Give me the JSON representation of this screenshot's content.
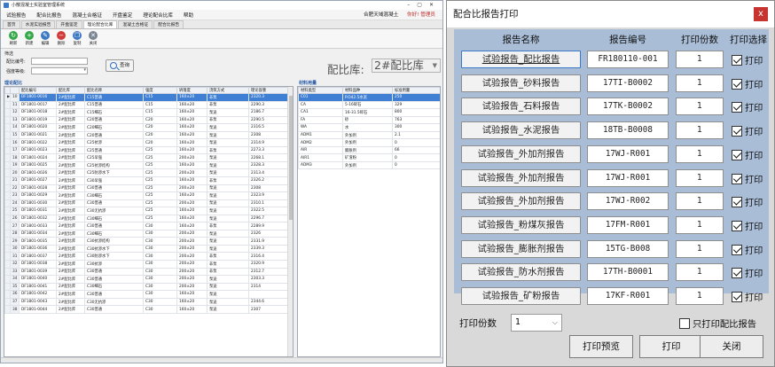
{
  "main_window": {
    "title": "小散混凝土实验室管理系统",
    "menu": [
      "试验报告",
      "配合比报告",
      "混凝土合格证",
      "开盘鉴定",
      "理论配合比库",
      "帮助"
    ],
    "company": "合肥天域混凝土",
    "user": "你好! 管理员",
    "tabs": [
      "首页",
      "水泥实验报告",
      "开盘鉴定",
      "理论配合比库",
      "混凝土合格证",
      "配合比报告"
    ],
    "active_tab_index": 3,
    "toolbar": [
      {
        "label": "刷新",
        "icon": "refresh-icon"
      },
      {
        "label": "新建",
        "icon": "add-icon"
      },
      {
        "label": "编辑",
        "icon": "edit-icon"
      },
      {
        "label": "删除",
        "icon": "delete-icon"
      },
      {
        "label": "复制",
        "icon": "copy-icon"
      },
      {
        "label": "关闭",
        "icon": "close-icon"
      }
    ],
    "filter": {
      "section_title": "筛选",
      "mix_no_label": "配比编号:",
      "strength_label": "强度等级:",
      "query_label": "查询",
      "library_label": "配比库:",
      "library_value": "2#配比库"
    },
    "mix_panel": {
      "title": "理论配比",
      "columns": [
        "",
        "",
        "配比编号",
        "配比库",
        "配比名称",
        "强度",
        "坍落度",
        "浇筑方式",
        "理论容重"
      ],
      "rows": [
        [
          "▶",
          "10",
          "DF1801-0016",
          "2#配比库",
          "C15普通",
          "C15",
          "160±20",
          "非泵",
          "2320.3"
        ],
        [
          "",
          "11",
          "DF1801-0017",
          "2#配比库",
          "C15普通",
          "C15",
          "160±20",
          "非泵",
          "2290.3"
        ],
        [
          "",
          "12",
          "DF1801-0018",
          "2#配比库",
          "C15细石",
          "C15",
          "160±20",
          "泵送",
          "2186.7"
        ],
        [
          "",
          "13",
          "DF1801-0019",
          "2#配比库",
          "C20普通",
          "C20",
          "160±20",
          "非泵",
          "2290.5"
        ],
        [
          "",
          "14",
          "DF1801-0020",
          "2#配比库",
          "C20细石",
          "C20",
          "160±20",
          "泵送",
          "2316.5"
        ],
        [
          "",
          "15",
          "DF1801-0021",
          "2#配比库",
          "C20普通",
          "C20",
          "160±20",
          "泵送",
          "2308"
        ],
        [
          "",
          "16",
          "DF1801-0022",
          "2#配比库",
          "C25抗渗",
          "C20",
          "160±20",
          "泵送",
          "2314.9"
        ],
        [
          "",
          "17",
          "DF1801-0023",
          "2#配比库",
          "C25普通",
          "C25",
          "160±20",
          "非泵",
          "2273.3"
        ],
        [
          "",
          "18",
          "DF1801-0024",
          "2#配比库",
          "C25早强",
          "C25",
          "200±20",
          "泵送",
          "2268.1"
        ],
        [
          "",
          "19",
          "DF1801-0025",
          "2#配比库",
          "C25抗渗结构",
          "C25",
          "160±20",
          "泵送",
          "2328.3"
        ],
        [
          "",
          "20",
          "DF1801-0026",
          "2#配比库",
          "C25防渗水下",
          "C25",
          "200±20",
          "泵送",
          "2313.4"
        ],
        [
          "",
          "21",
          "DF1801-0027",
          "2#配比库",
          "C30早强",
          "C25",
          "160±20",
          "非泵",
          "2326.2"
        ],
        [
          "",
          "22",
          "DF1801-0028",
          "2#配比库",
          "C30普通",
          "C25",
          "200±20",
          "泵送",
          "2308"
        ],
        [
          "",
          "23",
          "DF1801-0029",
          "2#配比库",
          "C30细石",
          "C25",
          "160±20",
          "泵送",
          "2323.9"
        ],
        [
          "",
          "24",
          "DF1801-0030",
          "2#配比库",
          "C30普通",
          "C25",
          "200±20",
          "泵送",
          "2310.1"
        ],
        [
          "",
          "25",
          "DF1801-0031",
          "2#配比库",
          "C30无抗渗",
          "C25",
          "160±20",
          "泵送",
          "2322.5"
        ],
        [
          "",
          "26",
          "DF1801-0032",
          "2#配比库",
          "C30细石",
          "C25",
          "160±20",
          "泵送",
          "2296.7"
        ],
        [
          "",
          "27",
          "DF1801-0033",
          "2#配比库",
          "C30普通",
          "C30",
          "160±20",
          "非泵",
          "2289.9"
        ],
        [
          "",
          "28",
          "DF1801-0034",
          "2#配比库",
          "C30细石",
          "C30",
          "200±20",
          "泵送",
          "2326"
        ],
        [
          "",
          "29",
          "DF1801-0035",
          "2#配比库",
          "C30抗渗结构",
          "C30",
          "200±20",
          "泵送",
          "2331.9"
        ],
        [
          "",
          "30",
          "DF1801-0036",
          "2#配比库",
          "C30抗渗水下",
          "C30",
          "200±20",
          "泵送",
          "2339.3"
        ],
        [
          "",
          "31",
          "DF1801-0037",
          "2#配比库",
          "C30防渗水下",
          "C30",
          "200±20",
          "非泵",
          "2316.4"
        ],
        [
          "",
          "32",
          "DF1801-0038",
          "2#配比库",
          "C30抗渗",
          "C30",
          "200±20",
          "非泵",
          "2320.9"
        ],
        [
          "",
          "33",
          "DF1801-0039",
          "2#配比库",
          "C30普通",
          "C30",
          "200±20",
          "非泵",
          "2312.7"
        ],
        [
          "",
          "34",
          "DF1801-0040",
          "2#配比库",
          "C30普通",
          "C30",
          "200±20",
          "泵送",
          "2303.3"
        ],
        [
          "",
          "35",
          "DF1801-0041",
          "2#配比库",
          "C30细石",
          "C30",
          "200±20",
          "泵送",
          "2314"
        ],
        [
          "",
          "36",
          "DF1801-0042",
          "2#配比库",
          "C30普通",
          "C30",
          "160±20",
          "泵送",
          ""
        ],
        [
          "",
          "37",
          "DF1801-0043",
          "2#配比库",
          "C30无抗渗",
          "C30",
          "160±20",
          "泵送",
          "2344.6"
        ],
        [
          "",
          "38",
          "DF1801-0044",
          "2#配比库",
          "C30普通",
          "C30",
          "160±20",
          "泵送",
          "2307"
        ]
      ]
    },
    "material_panel": {
      "title": "材料用量",
      "columns": [
        "材料类型",
        "材料品种",
        "标准用量"
      ],
      "rows": [
        [
          "C01",
          "P.O42.5水泥",
          "250"
        ],
        [
          "CA",
          "5-16碎石",
          "329"
        ],
        [
          "CA1",
          "16-31.5碎石",
          "800"
        ],
        [
          "FA",
          "砂",
          "763"
        ],
        [
          "WA",
          "水",
          "300"
        ],
        [
          "ADM1",
          "外加剂",
          "2.1"
        ],
        [
          "ADM2",
          "外加剂",
          "0"
        ],
        [
          "AIR",
          "膨胀剂",
          "66"
        ],
        [
          "AIR1",
          "矿渣粉",
          "0"
        ],
        [
          "ADM3",
          "外加剂",
          "0"
        ]
      ]
    }
  },
  "print_dialog": {
    "title": "配合比报告打印",
    "columns": {
      "name": "报告名称",
      "code": "报告编号",
      "copies": "打印份数",
      "select": "打印选择"
    },
    "reports": [
      {
        "name": "试验报告_配比报告",
        "code": "FR180110-001",
        "copies": "1",
        "select_label": "打印",
        "checked": true
      },
      {
        "name": "试验报告_砂料报告",
        "code": "17TI-B0002",
        "copies": "1",
        "select_label": "打印",
        "checked": true
      },
      {
        "name": "试验报告_石料报告",
        "code": "17TK-B0002",
        "copies": "1",
        "select_label": "打印",
        "checked": true
      },
      {
        "name": "试验报告_水泥报告",
        "code": "18TB-B0008",
        "copies": "1",
        "select_label": "打印",
        "checked": true
      },
      {
        "name": "试验报告_外加剂报告",
        "code": "17WJ-R001",
        "copies": "1",
        "select_label": "打印",
        "checked": true
      },
      {
        "name": "试验报告_外加剂报告",
        "code": "17WJ-R001",
        "copies": "1",
        "select_label": "打印",
        "checked": true
      },
      {
        "name": "试验报告_外加剂报告",
        "code": "17WJ-R002",
        "copies": "1",
        "select_label": "打印",
        "checked": true
      },
      {
        "name": "试验报告_粉煤灰报告",
        "code": "17FM-R001",
        "copies": "1",
        "select_label": "打印",
        "checked": true
      },
      {
        "name": "试验报告_膨胀剂报告",
        "code": "15TG-B008",
        "copies": "1",
        "select_label": "打印",
        "checked": true
      },
      {
        "name": "试验报告_防水剂报告",
        "code": "17TH-B0001",
        "copies": "1",
        "select_label": "打印",
        "checked": true
      },
      {
        "name": "试验报告_矿粉报告",
        "code": "17KF-R001",
        "copies": "1",
        "select_label": "打印",
        "checked": true
      }
    ],
    "copies_label": "打印份数",
    "copies_value": "1",
    "only_mix_label": "只打印配比报告",
    "only_mix_checked": false,
    "buttons": {
      "preview": "打印预览",
      "print": "打印",
      "close": "关闭"
    },
    "close_glyph": "x"
  },
  "colors": {
    "dialog_body": "#a9bdd6",
    "selection": "#3f7fd4",
    "close_red": "#c8342f"
  }
}
